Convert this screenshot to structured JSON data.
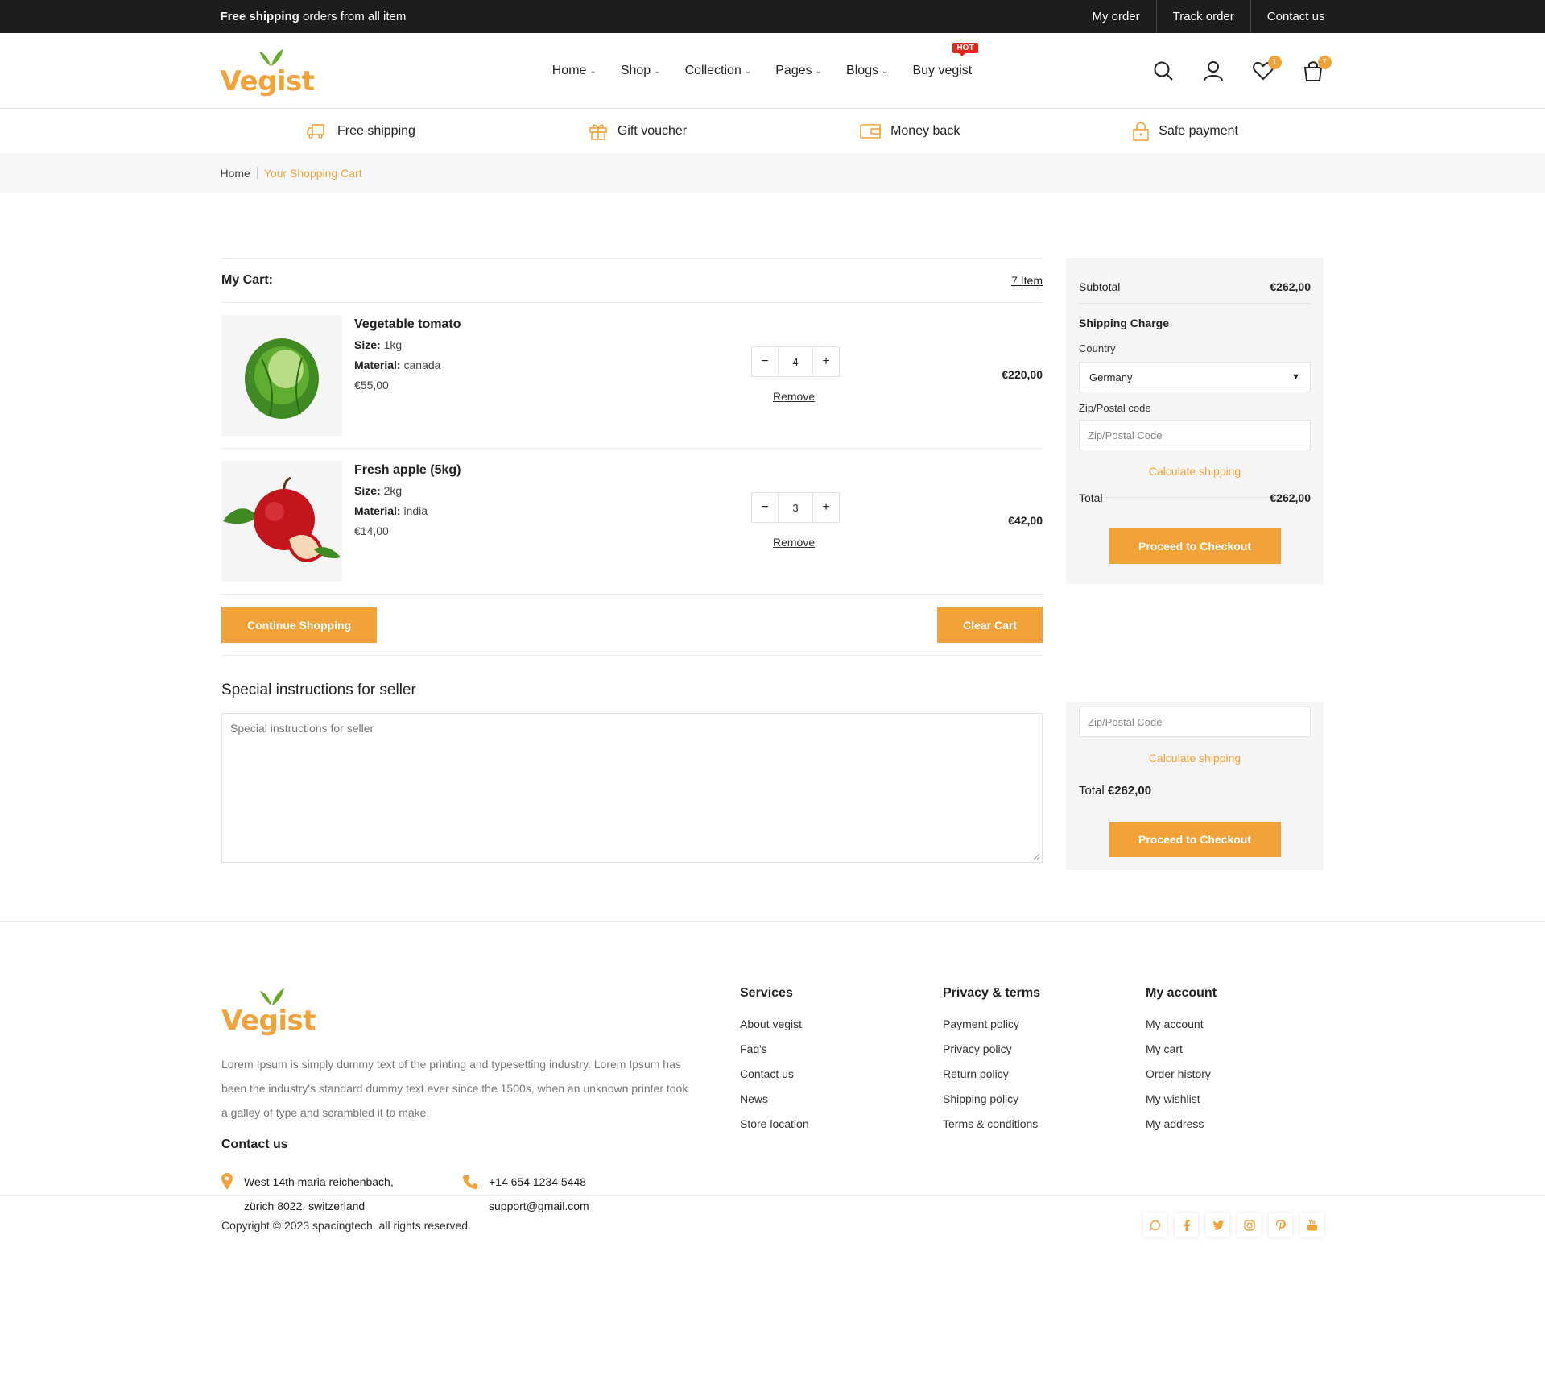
{
  "topbar": {
    "promo_bold": "Free shipping",
    "promo_rest": " orders from all item",
    "links": [
      "My order",
      "Track order",
      "Contact us"
    ]
  },
  "brand": {
    "logo_text": "Vegist",
    "accent": "#f1a33a",
    "leaf": "#6aa92b"
  },
  "nav": {
    "items": [
      "Home",
      "Shop",
      "Collection",
      "Pages",
      "Blogs",
      "Buy vegist"
    ],
    "hot_badge": "HOT"
  },
  "header_icons": {
    "wishlist_count": "1",
    "cart_count": "7"
  },
  "features": [
    "Free shipping",
    "Gift voucher",
    "Money back",
    "Safe payment"
  ],
  "breadcrumb": {
    "home": "Home",
    "current": "Your Shopping Cart"
  },
  "cart": {
    "title": "My Cart:",
    "count": "7 Item",
    "items": [
      {
        "name": "Vegetable tomato",
        "size_label": "Size:",
        "size": "1kg",
        "material_label": "Material:",
        "material": "canada",
        "price": "€55,00",
        "qty": "4",
        "remove": "Remove",
        "total": "€220,00"
      },
      {
        "name": "Fresh apple (5kg)",
        "size_label": "Size:",
        "size": "2kg",
        "material_label": "Material:",
        "material": "india",
        "price": "€14,00",
        "qty": "3",
        "remove": "Remove",
        "total": "€42,00"
      }
    ],
    "continue": "Continue Shopping",
    "clear": "Clear Cart",
    "special_title": "Special instructions for seller",
    "special_placeholder": "Special instructions for seller"
  },
  "summary": {
    "subtotal_label": "Subtotal",
    "subtotal": "€262,00",
    "shipping_title": "Shipping Charge",
    "country_label": "Country",
    "country": "Germany",
    "zip_label": "Zip/Postal code",
    "zip_placeholder": "Zip/Postal Code",
    "calc": "Calculate shipping",
    "total_label": "Total",
    "total": "€262,00",
    "checkout": "Proceed to Checkout"
  },
  "footer": {
    "desc": "Lorem Ipsum is simply dummy text of the printing and typesetting industry. Lorem Ipsum has been the industry's standard dummy text ever since the 1500s, when an unknown printer took a galley of type and scrambled it to make.",
    "contact_title": "Contact us",
    "address_line1": "West 14th maria reichenbach,",
    "address_line2": "zürich 8022, switzerland",
    "phone": "+14 654 1234 5448",
    "email": "support@gmail.com",
    "columns": [
      {
        "title": "Services",
        "links": [
          "About vegist",
          "Faq's",
          "Contact us",
          "News",
          "Store location"
        ]
      },
      {
        "title": "Privacy & terms",
        "links": [
          "Payment policy",
          "Privacy policy",
          "Return policy",
          "Shipping policy",
          "Terms & conditions"
        ]
      },
      {
        "title": "My account",
        "links": [
          "My account",
          "My cart",
          "Order history",
          "My wishlist",
          "My address"
        ]
      }
    ],
    "copyright": "Copyright © 2023 spacingtech. all rights reserved.",
    "socials": [
      "whatsapp-icon",
      "facebook-icon",
      "twitter-icon",
      "instagram-icon",
      "pinterest-icon",
      "youtube-icon"
    ]
  }
}
